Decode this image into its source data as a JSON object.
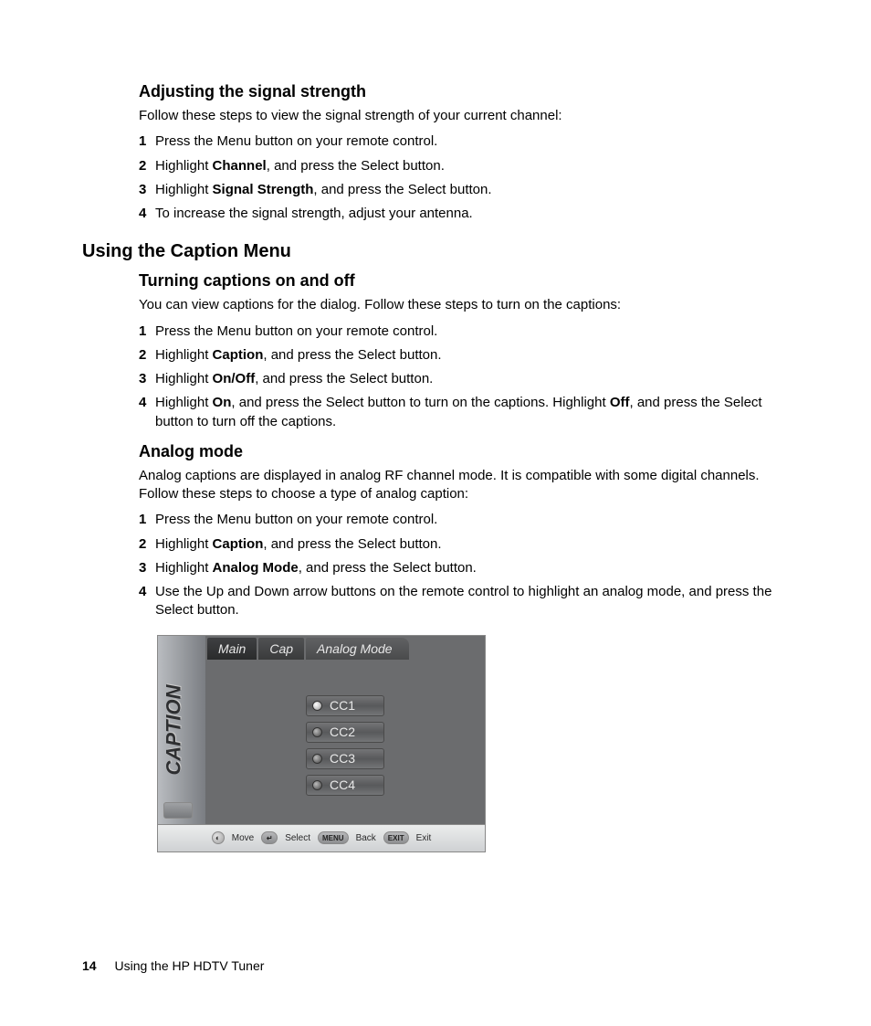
{
  "section1": {
    "heading": "Adjusting the signal strength",
    "intro": "Follow these steps to view the signal strength of your current channel:",
    "steps": [
      {
        "n": "1",
        "pre": "Press the Menu button on your remote control.",
        "bold": "",
        "post": ""
      },
      {
        "n": "2",
        "pre": "Highlight ",
        "bold": "Channel",
        "post": ", and press the Select button."
      },
      {
        "n": "3",
        "pre": "Highlight ",
        "bold": "Signal Strength",
        "post": ", and press the Select button."
      },
      {
        "n": "4",
        "pre": "To increase the signal strength, adjust your antenna.",
        "bold": "",
        "post": ""
      }
    ]
  },
  "h2": "Using the Caption Menu",
  "section2": {
    "heading": "Turning captions on and off",
    "intro": "You can view captions for the dialog. Follow these steps to turn on the captions:",
    "steps": [
      {
        "n": "1",
        "pre": "Press the Menu button on your remote control.",
        "bold": "",
        "post": ""
      },
      {
        "n": "2",
        "pre": "Highlight ",
        "bold": "Caption",
        "post": ", and press the Select button."
      },
      {
        "n": "3",
        "pre": "Highlight ",
        "bold": "On/Off",
        "post": ", and press the Select button."
      }
    ],
    "step4": {
      "n": "4",
      "pre": "Highlight ",
      "bold1": "On",
      "mid": ", and press the Select button to turn on the captions. Highlight ",
      "bold2": "Off",
      "post": ", and press the Select button to turn off the captions."
    }
  },
  "section3": {
    "heading": "Analog mode",
    "intro": "Analog captions are displayed in analog RF channel mode. It is compatible with some digital channels. Follow these steps to choose a type of analog caption:",
    "steps": [
      {
        "n": "1",
        "pre": "Press the Menu button on your remote control.",
        "bold": "",
        "post": ""
      },
      {
        "n": "2",
        "pre": "Highlight ",
        "bold": "Caption",
        "post": ", and press the Select button."
      },
      {
        "n": "3",
        "pre": "Highlight ",
        "bold": "Analog Mode",
        "post": ", and press the Select button."
      },
      {
        "n": "4",
        "pre": "Use the Up and Down arrow buttons on the remote control to highlight an analog mode, and press the Select button.",
        "bold": "",
        "post": ""
      }
    ]
  },
  "osd": {
    "sidebar_label": "CAPTION",
    "tabs": [
      "Main",
      "Cap",
      "Analog Mode"
    ],
    "options": [
      {
        "label": "CC1",
        "selected": true
      },
      {
        "label": "CC2",
        "selected": false
      },
      {
        "label": "CC3",
        "selected": false
      },
      {
        "label": "CC4",
        "selected": false
      }
    ],
    "footer": {
      "move": "Move",
      "select": "Select",
      "menu": "MENU",
      "back": "Back",
      "exit": "EXIT",
      "exit2": "Exit"
    }
  },
  "footer": {
    "page": "14",
    "title": "Using the HP HDTV Tuner"
  }
}
